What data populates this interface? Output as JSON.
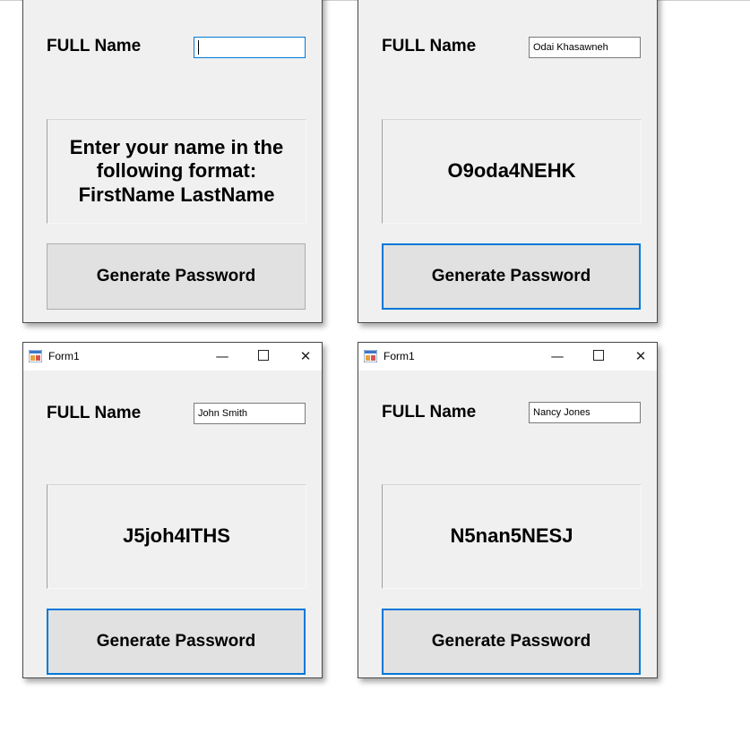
{
  "colors": {
    "form_background": "#f0f0f0",
    "titlebar": "#ffffff",
    "button_face": "#e1e1e1",
    "focus_accent": "#0078d7"
  },
  "icons": {
    "app": "winforms-app-icon",
    "minimize": "minimize-icon",
    "maximize": "maximize-icon",
    "close": "close-icon"
  },
  "forms": [
    {
      "name_label": "FULL Name",
      "name_value": "",
      "output_text": "Enter your name in the following format: FirstName LastName",
      "button_label": "Generate Password"
    },
    {
      "name_label": "FULL Name",
      "name_value": "Odai Khasawneh",
      "output_text": "O9oda4NEHK",
      "button_label": "Generate Password"
    },
    {
      "title": "Form1",
      "minimize_glyph": "—",
      "close_glyph": "✕",
      "name_label": "FULL Name",
      "name_value": "John Smith",
      "output_text": "J5joh4ITHS",
      "button_label": "Generate Password"
    },
    {
      "title": "Form1",
      "minimize_glyph": "—",
      "close_glyph": "✕",
      "name_label": "FULL Name",
      "name_value": "Nancy Jones",
      "output_text": "N5nan5NESJ",
      "button_label": "Generate Password"
    }
  ]
}
